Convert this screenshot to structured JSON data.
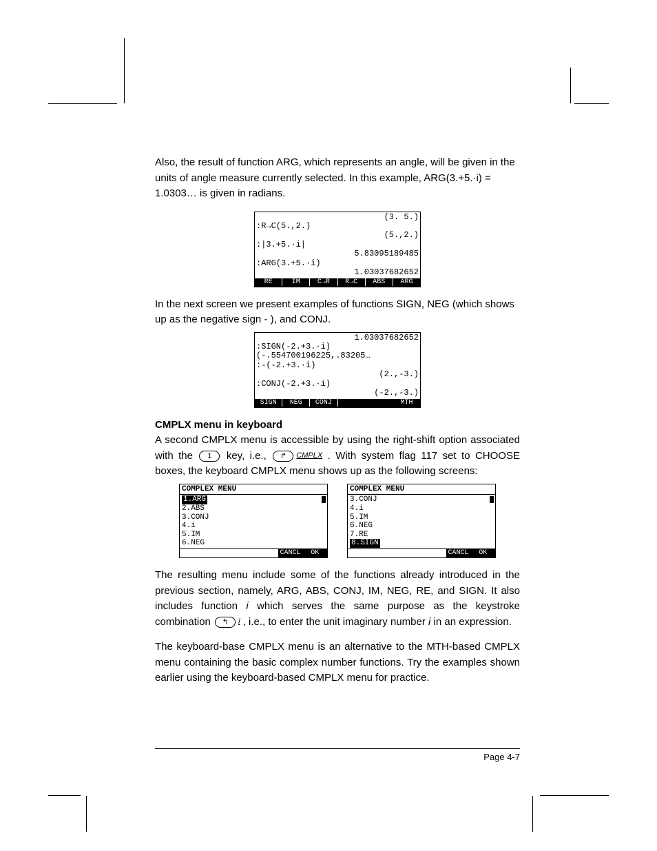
{
  "para1": "Also, the result of function ARG, which represents an angle, will be given in the units of angle measure currently selected.  In this example, ARG(3.+5.·i) = 1.0303… is given in radians.",
  "screen1": {
    "lines": [
      {
        "cls": "r",
        "txt": "(3. 5.)"
      },
      {
        "cls": "l",
        "txt": ":R→C(5.,2.)"
      },
      {
        "cls": "r",
        "txt": "(5.,2.)"
      },
      {
        "cls": "l",
        "txt": ":|3.+5.·i|"
      },
      {
        "cls": "r",
        "txt": "5.83095189485"
      },
      {
        "cls": "l",
        "txt": ":ARG(3.+5.·i)"
      },
      {
        "cls": "r",
        "txt": "1.03037682652"
      }
    ],
    "soft": [
      "RE",
      "IM",
      "C→R",
      "R→C",
      "ABS",
      "ARG"
    ]
  },
  "para2": "In the next screen we present examples of functions SIGN, NEG (which shows up as the negative sign - ), and CONJ.",
  "screen2": {
    "lines": [
      {
        "cls": "r",
        "txt": "1.03037682652"
      },
      {
        "cls": "l",
        "txt": ":SIGN(-2.+3.·i)"
      },
      {
        "cls": "l",
        "txt": "(-.554700196225,.83205…"
      },
      {
        "cls": "l",
        "txt": ":-(-2.+3.·i)"
      },
      {
        "cls": "r",
        "txt": "(2.,-3.)"
      },
      {
        "cls": "l",
        "txt": ":CONJ(-2.+3.·i)"
      },
      {
        "cls": "r",
        "txt": "(-2.,-3.)"
      }
    ],
    "soft": [
      "SIGN",
      "NEG",
      "CONJ",
      "",
      "",
      "MTH"
    ]
  },
  "heading": "CMPLX menu in keyboard",
  "para3a": "A second CMPLX menu is accessible by using the right-shift option associated with the ",
  "key1": "1",
  "para3b": " key, i.e., ",
  "key2": "↱",
  "key2label": "CMPLX",
  "para3c": ".  With system flag 117 set to CHOOSE boxes, the keyboard CMPLX menu shows up as the following screens:",
  "chooseA": {
    "title": "COMPLEX MENU",
    "items": [
      "1.ARG",
      "2.ABS",
      "3.CONJ",
      "4.i",
      "5.IM",
      "6.NEG"
    ],
    "hiliteIndex": 0,
    "soft": [
      "",
      "",
      "",
      "",
      "CANCL",
      "OK"
    ]
  },
  "chooseB": {
    "title": "COMPLEX MENU",
    "items": [
      "3.CONJ",
      "4.i",
      "5.IM",
      "6.NEG",
      "7.RE",
      "8.SIGN"
    ],
    "hiliteIndex": 5,
    "soft": [
      "",
      "",
      "",
      "",
      "CANCL",
      "OK"
    ]
  },
  "para4a": "The resulting menu include some of the functions already introduced in the previous section, namely, ARG, ABS, CONJ, IM, NEG, RE, and SIGN.  It also includes function ",
  "para4a_i": "i",
  "para4b": " which serves the same purpose as the keystroke combination ",
  "key3": "↰",
  "key3label": "i",
  "para4c": ", i.e., to enter the unit imaginary number ",
  "para4c_i": "i",
  "para4d": " in an expression.",
  "para5": "The keyboard-base CMPLX menu is an alternative to the MTH-based CMPLX menu containing the basic complex number functions.  Try the examples shown earlier using the keyboard-based CMPLX menu for practice.",
  "pagenum": "Page 4-7"
}
